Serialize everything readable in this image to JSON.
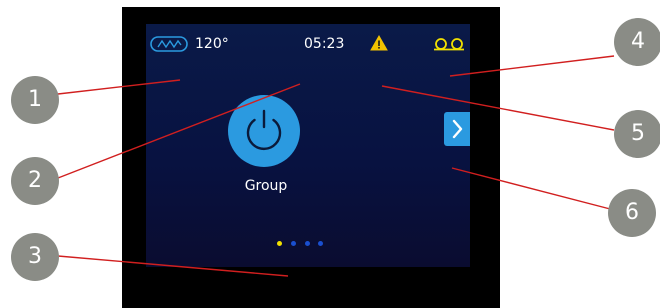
{
  "status_bar": {
    "temperature": "120°",
    "time": "05:23"
  },
  "main": {
    "group_label": "Group"
  },
  "callouts": [
    "1",
    "2",
    "3",
    "4",
    "5",
    "6"
  ],
  "colors": {
    "screen_background": "#081241",
    "power_button": "#2b9ae0",
    "warning": "#f2c200",
    "active_page_dot": "#f2e000",
    "inactive_page_dot": "#1a4fd0",
    "leader_line": "#d11f1f",
    "callout_badge": "#8a8c86"
  },
  "icons": [
    "heater-wave-icon",
    "warning-triangle-icon",
    "cassette-icon",
    "power-icon",
    "chevron-right-icon"
  ],
  "pagination": {
    "current_page": 1,
    "total_pages": 4
  }
}
